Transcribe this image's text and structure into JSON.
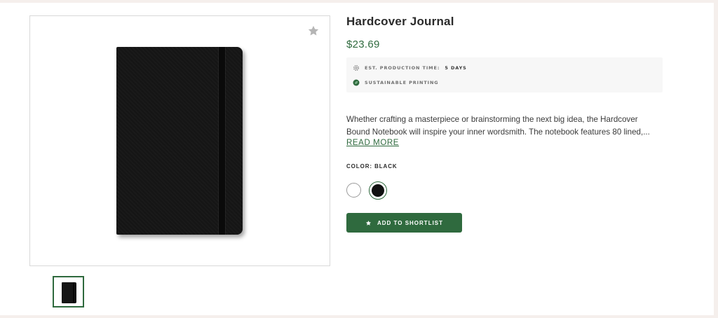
{
  "product": {
    "title": "Hardcover Journal",
    "price": "$23.69",
    "info": {
      "production_label": "EST. PRODUCTION TIME:",
      "production_value": "5 DAYS",
      "production_icon": "gear-icon",
      "sustainable_label": "SUSTAINABLE PRINTING",
      "sustainable_icon": "leaf-icon"
    },
    "description_line1": "Whether crafting a masterpiece or brainstorming the next big idea, the Hardcover",
    "description_line2": "Bound Notebook will inspire your inner wordsmith. The notebook features 80 lined,...",
    "read_more": "READ MORE",
    "color_label": "COLOR: BLACK",
    "colors": [
      {
        "name": "white",
        "hex": "#ffffff",
        "selected": false
      },
      {
        "name": "black",
        "hex": "#111111",
        "selected": true
      }
    ],
    "add_button": "ADD TO SHORTLIST",
    "favorite_icon": "star-icon"
  },
  "theme": {
    "accent": "#2f6a3e",
    "page_background": "#f5efec"
  }
}
